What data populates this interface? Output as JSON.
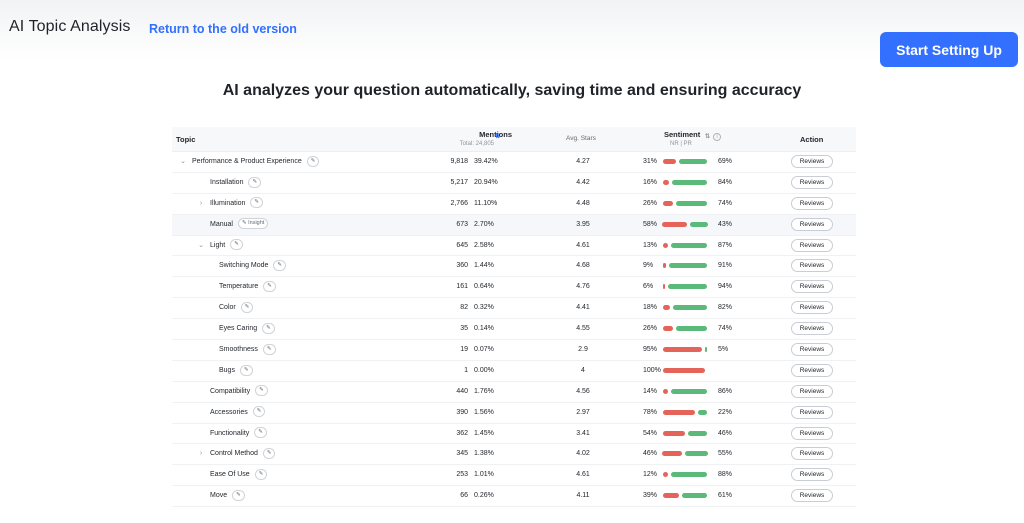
{
  "header": {
    "title": "AI Topic Analysis",
    "old_version_link": "Return to the old version",
    "cta_label": "Start Setting Up"
  },
  "headline": "AI analyzes your question automatically, saving time and ensuring accuracy",
  "table": {
    "columns": {
      "topic": "Topic",
      "mentions": "Mentions",
      "mentions_total": "Total: 24,805",
      "avg_stars": "Avg. Stars",
      "sentiment": "Sentiment",
      "sentiment_sub": "NR | PR",
      "action": "Action"
    },
    "review_label": "Reviews",
    "rows": [
      {
        "name": "Performance & Product Experience",
        "level": 0,
        "caret": "v",
        "tag": "",
        "count": "9,818",
        "pct": "39.42%",
        "stars": "4.27",
        "nr": "31%",
        "pr": "69%",
        "nr_v": 31,
        "pr_v": 69
      },
      {
        "name": "Installation",
        "level": 1,
        "caret": "",
        "tag": "",
        "count": "5,217",
        "pct": "20.94%",
        "stars": "4.42",
        "nr": "16%",
        "pr": "84%",
        "nr_v": 16,
        "pr_v": 84
      },
      {
        "name": "Illumination",
        "level": 1,
        "caret": ">",
        "tag": "",
        "count": "2,766",
        "pct": "11.10%",
        "stars": "4.48",
        "nr": "26%",
        "pr": "74%",
        "nr_v": 26,
        "pr_v": 74
      },
      {
        "name": "Manual",
        "level": 1,
        "caret": "",
        "tag": "Insight",
        "count": "673",
        "pct": "2.70%",
        "stars": "3.95",
        "nr": "58%",
        "pr": "43%",
        "nr_v": 58,
        "pr_v": 43,
        "highlight": true
      },
      {
        "name": "Light",
        "level": 1,
        "caret": "v",
        "tag": "",
        "count": "645",
        "pct": "2.58%",
        "stars": "4.61",
        "nr": "13%",
        "pr": "87%",
        "nr_v": 13,
        "pr_v": 87
      },
      {
        "name": "Switching Mode",
        "level": 2,
        "caret": "",
        "tag": "",
        "count": "360",
        "pct": "1.44%",
        "stars": "4.68",
        "nr": "9%",
        "pr": "91%",
        "nr_v": 9,
        "pr_v": 91
      },
      {
        "name": "Temperature",
        "level": 2,
        "caret": "",
        "tag": "",
        "count": "161",
        "pct": "0.64%",
        "stars": "4.76",
        "nr": "6%",
        "pr": "94%",
        "nr_v": 6,
        "pr_v": 94
      },
      {
        "name": "Color",
        "level": 2,
        "caret": "",
        "tag": "",
        "count": "82",
        "pct": "0.32%",
        "stars": "4.41",
        "nr": "18%",
        "pr": "82%",
        "nr_v": 18,
        "pr_v": 82
      },
      {
        "name": "Eyes Caring",
        "level": 2,
        "caret": "",
        "tag": "",
        "count": "35",
        "pct": "0.14%",
        "stars": "4.55",
        "nr": "26%",
        "pr": "74%",
        "nr_v": 26,
        "pr_v": 74
      },
      {
        "name": "Smoothness",
        "level": 2,
        "caret": "",
        "tag": "",
        "count": "19",
        "pct": "0.07%",
        "stars": "2.9",
        "nr": "95%",
        "pr": "5%",
        "nr_v": 95,
        "pr_v": 5
      },
      {
        "name": "Bugs",
        "level": 2,
        "caret": "",
        "tag": "",
        "count": "1",
        "pct": "0.00%",
        "stars": "4",
        "nr": "100%",
        "pr": "",
        "nr_v": 100,
        "pr_v": 0
      },
      {
        "name": "Compatibility",
        "level": 1,
        "caret": "",
        "tag": "",
        "count": "440",
        "pct": "1.76%",
        "stars": "4.56",
        "nr": "14%",
        "pr": "86%",
        "nr_v": 14,
        "pr_v": 86
      },
      {
        "name": "Accessories",
        "level": 1,
        "caret": "",
        "tag": "",
        "count": "390",
        "pct": "1.56%",
        "stars": "2.97",
        "nr": "78%",
        "pr": "22%",
        "nr_v": 78,
        "pr_v": 22
      },
      {
        "name": "Functionality",
        "level": 1,
        "caret": "",
        "tag": "",
        "count": "362",
        "pct": "1.45%",
        "stars": "3.41",
        "nr": "54%",
        "pr": "46%",
        "nr_v": 54,
        "pr_v": 46
      },
      {
        "name": "Control Method",
        "level": 1,
        "caret": ">",
        "tag": "",
        "count": "345",
        "pct": "1.38%",
        "stars": "4.02",
        "nr": "46%",
        "pr": "55%",
        "nr_v": 46,
        "pr_v": 55
      },
      {
        "name": "Ease Of Use",
        "level": 1,
        "caret": "",
        "tag": "",
        "count": "253",
        "pct": "1.01%",
        "stars": "4.61",
        "nr": "12%",
        "pr": "88%",
        "nr_v": 12,
        "pr_v": 88
      },
      {
        "name": "Move",
        "level": 1,
        "caret": "",
        "tag": "",
        "count": "66",
        "pct": "0.26%",
        "stars": "4.11",
        "nr": "39%",
        "pr": "61%",
        "nr_v": 39,
        "pr_v": 61
      }
    ]
  },
  "colors": {
    "accent": "#3370ff",
    "negative": "#e5645a",
    "positive": "#5bb97a"
  },
  "icons": {
    "edit": "edit-icon",
    "sort": "sort-icon",
    "info": "info-icon",
    "caret": "chevron-icon"
  }
}
